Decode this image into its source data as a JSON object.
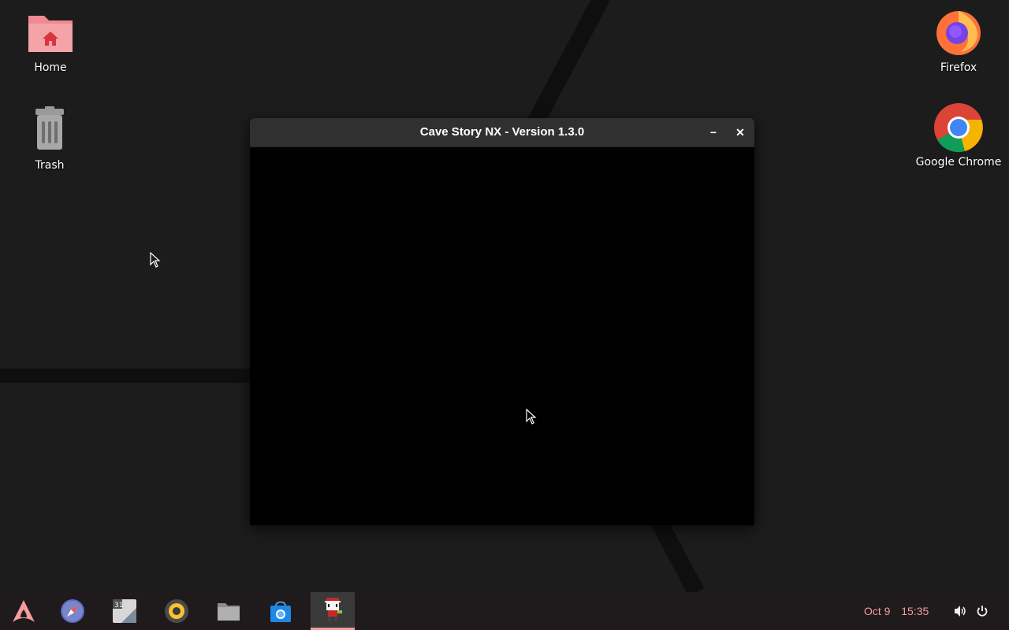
{
  "desktop": {
    "icons": [
      {
        "label": "Home",
        "icon": "home-folder-icon"
      },
      {
        "label": "Trash",
        "icon": "trash-icon"
      },
      {
        "label": "Firefox",
        "icon": "firefox-icon"
      },
      {
        "label": "Google Chrome",
        "icon": "chrome-icon"
      }
    ]
  },
  "window": {
    "title": "Cave Story NX - Version 1.3.0",
    "minimize_glyph": "−",
    "close_glyph": "✕"
  },
  "taskbar": {
    "apps": [
      {
        "name": "app-menu",
        "icon": "arch-logo-icon"
      },
      {
        "name": "web-browser",
        "icon": "compass-icon"
      },
      {
        "name": "calendar",
        "icon": "calendar-icon",
        "text": "31"
      },
      {
        "name": "music-player",
        "icon": "speaker-icon"
      },
      {
        "name": "files",
        "icon": "folder-icon"
      },
      {
        "name": "software-store",
        "icon": "store-bag-icon"
      },
      {
        "name": "cave-story",
        "icon": "quote-sprite-icon",
        "active": true
      }
    ],
    "clock": {
      "date": "Oct 9",
      "time": "15:35"
    },
    "tray": [
      {
        "name": "volume",
        "icon": "volume-icon"
      },
      {
        "name": "power",
        "icon": "power-icon"
      }
    ]
  },
  "colors": {
    "accent": "#f29ca0",
    "titlebar": "#303030",
    "desktop": "#1c1c1c",
    "taskbar": "#1f1a1c"
  }
}
